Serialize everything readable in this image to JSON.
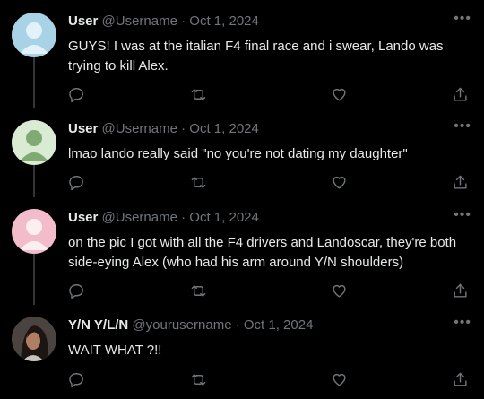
{
  "tweets": [
    {
      "name": "User",
      "handle": "@Username",
      "sep": "·",
      "date": "Oct 1, 2024",
      "text": "GUYS! I was at the italian F4 final race and i swear, Lando was trying to kill Alex.",
      "avatar": "default-avatar",
      "avatar_color": "#a8d3e6"
    },
    {
      "name": "User",
      "handle": "@Username",
      "sep": "·",
      "date": "Oct 1, 2024",
      "text": "lmao lando really said \"no you're not dating my daughter\"",
      "avatar": "default-avatar",
      "avatar_color": "#a4c79a"
    },
    {
      "name": "User",
      "handle": "@Username",
      "sep": "·",
      "date": "Oct 1, 2024",
      "text": "on the pic I got with all the F4 drivers and Landoscar, they're both side-eying Alex (who had his arm around Y/N shoulders)",
      "avatar": "default-avatar",
      "avatar_color": "#f3bccb"
    },
    {
      "name": "Y/N Y/L/N",
      "handle": "@yourusername",
      "sep": "·",
      "date": "Oct 1, 2024",
      "text": "WAIT WHAT ?!!",
      "avatar": "photo-avatar"
    }
  ],
  "icons": [
    "more-icon",
    "reply-icon",
    "retweet-icon",
    "like-icon",
    "share-icon"
  ],
  "more_label": "•••",
  "colors": {
    "background": "#000000",
    "text": "#e7e9ea",
    "muted": "#71767b",
    "line": "#333639"
  }
}
